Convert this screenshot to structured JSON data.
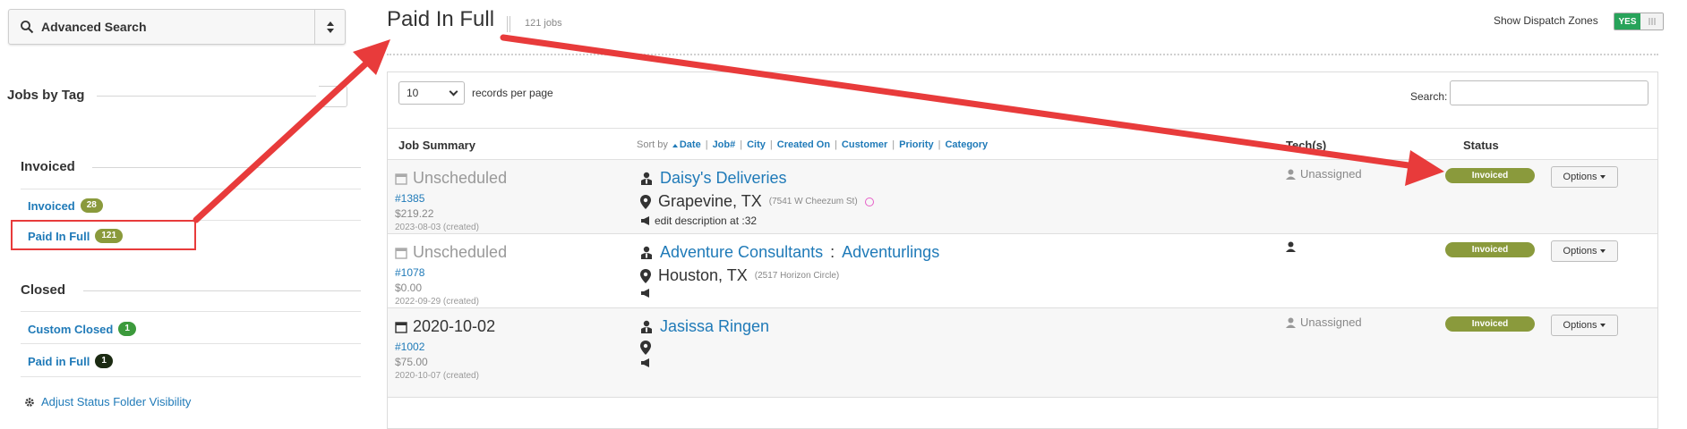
{
  "sidebar": {
    "advanced_search": "Advanced Search",
    "jobs_by_tag": "Jobs by Tag",
    "sections": [
      {
        "title": "Invoiced",
        "items": [
          {
            "label": "Invoiced",
            "count": "28",
            "badge_color": "#8a9a3c"
          },
          {
            "label": "Paid In Full",
            "count": "121",
            "badge_color": "#8a9a3c"
          }
        ]
      },
      {
        "title": "Closed",
        "items": [
          {
            "label": "Custom Closed",
            "count": "1",
            "badge_color": "#3c9a3c"
          },
          {
            "label": "Paid in Full",
            "count": "1",
            "badge_color": "#1b2a12"
          }
        ]
      }
    ],
    "adjust_link": "Adjust Status Folder Visibility"
  },
  "header": {
    "title": "Paid In Full",
    "job_count": "121 jobs",
    "dispatch_label": "Show Dispatch Zones",
    "dispatch_toggle": "YES"
  },
  "table_controls": {
    "page_size": "10",
    "records_label": "records per page",
    "search_label": "Search:",
    "search_value": ""
  },
  "columns": {
    "job_summary": "Job Summary",
    "sort_by": "Sort by",
    "sort_options": [
      "Date",
      "Job#",
      "City",
      "Created On",
      "Customer",
      "Priority",
      "Category"
    ],
    "techs": "Tech(s)",
    "status": "Status"
  },
  "rows": [
    {
      "date": "Unscheduled",
      "job_number": "#1385",
      "price": "$219.22",
      "created": "2023-08-03 (created)",
      "customer": "Daisy's Deliveries",
      "sub_customer": "",
      "city": "Grapevine, TX",
      "address": "(7541 W Cheezum St)",
      "description": "edit description at :32",
      "tech": "Unassigned",
      "status": "Invoiced",
      "options": "Options"
    },
    {
      "date": "Unscheduled",
      "job_number": "#1078",
      "price": "$0.00",
      "created": "2022-09-29 (created)",
      "customer": "Adventure Consultants",
      "sub_customer": "Adventurlings",
      "city": "Houston, TX",
      "address": "(2517 Horizon Circle)",
      "description": "",
      "tech": "",
      "status": "Invoiced",
      "options": "Options"
    },
    {
      "date": "2020-10-02",
      "job_number": "#1002",
      "price": "$75.00",
      "created": "2020-10-07 (created)",
      "customer": "Jasissa Ringen",
      "sub_customer": "",
      "city": "",
      "address": "",
      "description": "",
      "tech": "Unassigned",
      "status": "Invoiced",
      "options": "Options"
    }
  ],
  "colors": {
    "accent_link": "#1f7ab8",
    "status_invoiced": "#8a9a3c",
    "annotation_red": "#e83b3b",
    "toggle_green": "#27a35a"
  }
}
